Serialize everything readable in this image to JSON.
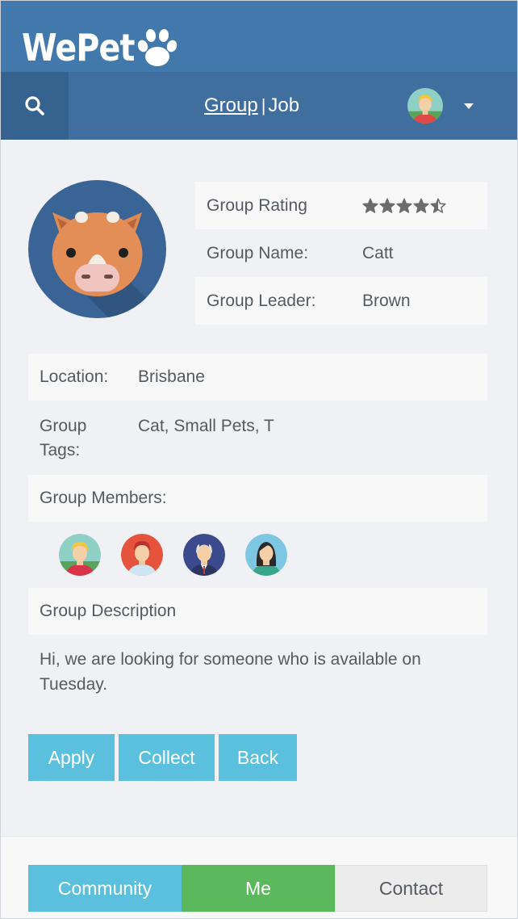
{
  "brand": {
    "name": "WePet",
    "paw_icon": "paw-icon"
  },
  "nav": {
    "search_icon": "search-icon",
    "group_label": "Group",
    "separator": "|",
    "job_label": "Job",
    "user_menu_icon": "chevron-down-icon"
  },
  "profile": {
    "avatar_icon": "cow-avatar-icon",
    "rating_label": "Group Rating",
    "rating_value": 4.5,
    "rating_max": 5,
    "name_label": "Group Name:",
    "name_value": "Catt",
    "leader_label": "Group Leader:",
    "leader_value": "Brown"
  },
  "details": {
    "location_label": "Location:",
    "location_value": "Brisbane",
    "tags_label": "Group Tags:",
    "tags_value": "Cat, Small Pets, T",
    "members_label": "Group Members:",
    "members": [
      {
        "name": "member-blond-man"
      },
      {
        "name": "member-red-hair-man"
      },
      {
        "name": "member-elder-man"
      },
      {
        "name": "member-woman"
      }
    ],
    "description_label": "Group Description",
    "description_text": "Hi, we are looking for someone who is available on Tuesday."
  },
  "actions": {
    "apply": "Apply",
    "collect": "Collect",
    "back": "Back"
  },
  "footer": {
    "community": "Community",
    "me": "Me",
    "contact": "Contact"
  },
  "colors": {
    "brand_bar": "#4279ad",
    "nav_bar": "#3f6e9f",
    "info_button": "#5bc0de",
    "success_tab": "#5cb85c",
    "background": "#f0f1f5"
  }
}
